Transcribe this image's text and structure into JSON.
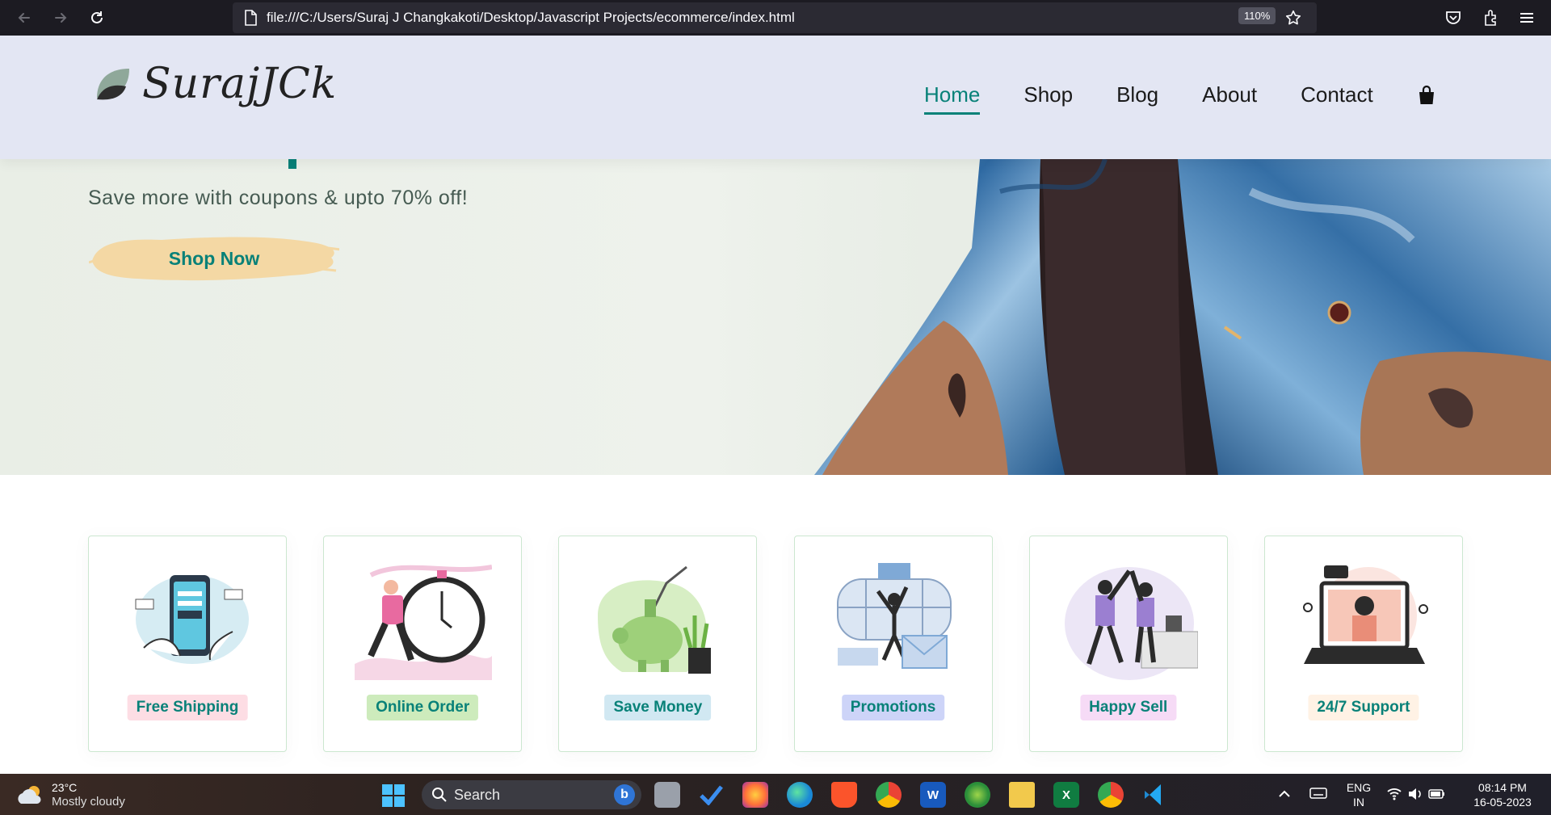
{
  "browser": {
    "url": "file:///C:/Users/Suraj J Changkakoti/Desktop/Javascript Projects/ecommerce/index.html",
    "zoom": "110%"
  },
  "header": {
    "logo_text": "SurajJCk",
    "nav": [
      {
        "label": "Home",
        "active": true
      },
      {
        "label": "Shop",
        "active": false
      },
      {
        "label": "Blog",
        "active": false
      },
      {
        "label": "About",
        "active": false
      },
      {
        "label": "Contact",
        "active": false
      }
    ],
    "cart_icon": "shopping-bag-icon"
  },
  "hero": {
    "subtitle": "Save more with coupons & upto 70% off!",
    "cta_label": "Shop Now",
    "cta_bg_color": "#f4d8a4",
    "accent_color": "#088178"
  },
  "features": [
    {
      "label": "Free Shipping",
      "tag_color": "#fddde4",
      "icon": "phone-payment-illustration"
    },
    {
      "label": "Online Order",
      "tag_color": "#cdebbc",
      "icon": "stopwatch-runner-illustration"
    },
    {
      "label": "Save Money",
      "tag_color": "#d1e8f2",
      "icon": "piggy-bank-illustration"
    },
    {
      "label": "Promotions",
      "tag_color": "#cdd4f8",
      "icon": "promotion-gift-illustration"
    },
    {
      "label": "Happy Sell",
      "tag_color": "#f6dbf6",
      "icon": "high-five-illustration"
    },
    {
      "label": "24/7 Support",
      "tag_color": "#fff2e5",
      "icon": "laptop-support-illustration"
    }
  ],
  "taskbar": {
    "weather_temp": "23°C",
    "weather_desc": "Mostly cloudy",
    "search_label": "Search",
    "lang_top": "ENG",
    "lang_bottom": "IN",
    "time": "08:14 PM",
    "date": "16-05-2023"
  }
}
